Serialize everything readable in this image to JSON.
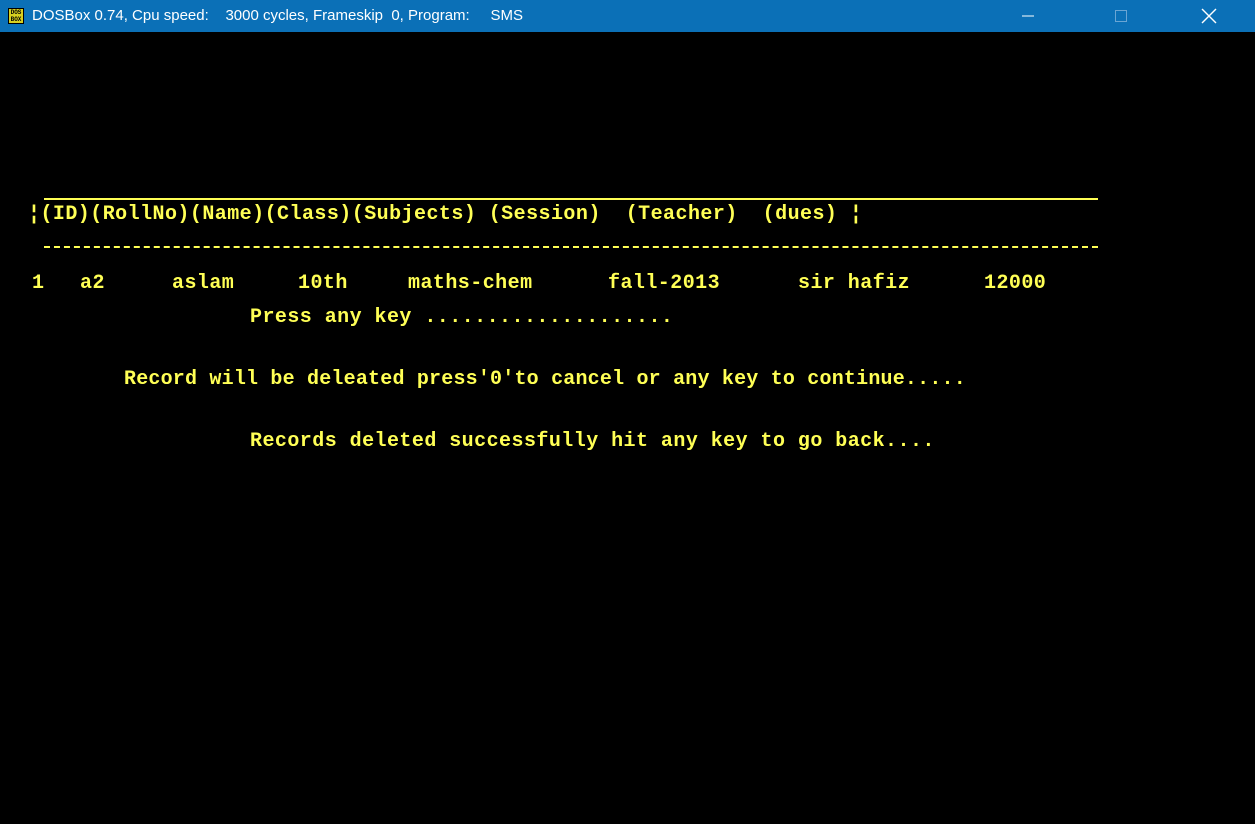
{
  "window": {
    "title": "DOSBox 0.74, Cpu speed:    3000 cycles, Frameskip  0, Program:     SMS",
    "icon": "dosbox-icon",
    "controls": {
      "minimize": "minimize-icon",
      "maximize": "maximize-icon",
      "close": "close-icon"
    }
  },
  "terminal": {
    "text_color": "#ffff55",
    "background": "#000000",
    "table_header": "¦(ID)(RollNo)(Name)(Class)(Subjects) (Session)  (Teacher)  (dues) ¦",
    "record": {
      "id": "1",
      "roll_no": "a2",
      "name": "aslam",
      "class": "10th",
      "subjects": "maths-chem",
      "session": "fall-2013",
      "teacher": "sir hafiz",
      "dues": "12000"
    },
    "press_any_key": "Press any key ....................",
    "confirm_message": "Record will be deleated press'0'to cancel or any key to continue.....",
    "success_message": "Records deleted successfully hit any key to go back...."
  }
}
